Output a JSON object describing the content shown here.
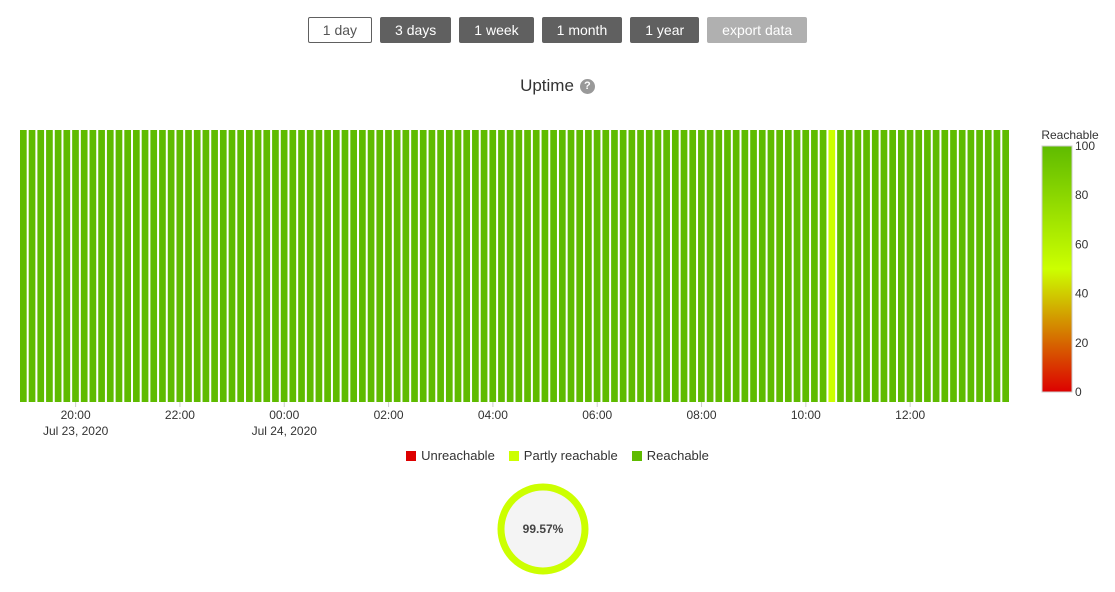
{
  "toolbar": {
    "buttons": [
      {
        "label": "1 day",
        "state": "active"
      },
      {
        "label": "3 days",
        "state": "normal"
      },
      {
        "label": "1 week",
        "state": "normal"
      },
      {
        "label": "1 month",
        "state": "normal"
      },
      {
        "label": "1 year",
        "state": "normal"
      },
      {
        "label": "export data",
        "state": "disabled"
      }
    ]
  },
  "chart_title": "Uptime",
  "help_icon": "question-circle-icon",
  "colors": {
    "unreachable": "#dd0000",
    "partly_reachable": "#ccff00",
    "reachable": "#5fbb00",
    "button_dark": "#606060",
    "button_disabled": "#b0b0b0"
  },
  "chart_data": {
    "type": "heatmap",
    "title": "Uptime",
    "x_range": [
      "2020-07-23T18:56",
      "2020-07-24T13:56"
    ],
    "interval_minutes": 10,
    "bucket_count": 114,
    "partly_reachable_buckets": [
      {
        "start": "2020-07-24T10:26",
        "value": 50
      }
    ],
    "default_value": 100,
    "x_ticks": [
      {
        "time": "2020-07-23T20:00",
        "label": "20:00",
        "date_label": "Jul 23, 2020"
      },
      {
        "time": "2020-07-23T22:00",
        "label": "22:00",
        "date_label": ""
      },
      {
        "time": "2020-07-24T00:00",
        "label": "00:00",
        "date_label": "Jul 24, 2020"
      },
      {
        "time": "2020-07-24T02:00",
        "label": "02:00",
        "date_label": ""
      },
      {
        "time": "2020-07-24T04:00",
        "label": "04:00",
        "date_label": ""
      },
      {
        "time": "2020-07-24T06:00",
        "label": "06:00",
        "date_label": ""
      },
      {
        "time": "2020-07-24T08:00",
        "label": "08:00",
        "date_label": ""
      },
      {
        "time": "2020-07-24T10:00",
        "label": "10:00",
        "date_label": ""
      },
      {
        "time": "2020-07-24T12:00",
        "label": "12:00",
        "date_label": ""
      }
    ],
    "color_axis": {
      "title": "Reachable",
      "range": [
        0,
        100
      ],
      "ticks": [
        0,
        20,
        40,
        60,
        80,
        100
      ],
      "stops": [
        {
          "value": 0,
          "color": "#dd0000"
        },
        {
          "value": 50,
          "color": "#ccff00"
        },
        {
          "value": 100,
          "color": "#5fbb00"
        }
      ]
    },
    "legend": [
      {
        "name": "Unreachable",
        "color": "#dd0000"
      },
      {
        "name": "Partly reachable",
        "color": "#ccff00"
      },
      {
        "name": "Reachable",
        "color": "#5fbb00"
      }
    ],
    "legend_placement": "bottom-center",
    "summary": {
      "uptime_percent": 99.57,
      "label": "99.57%"
    }
  }
}
